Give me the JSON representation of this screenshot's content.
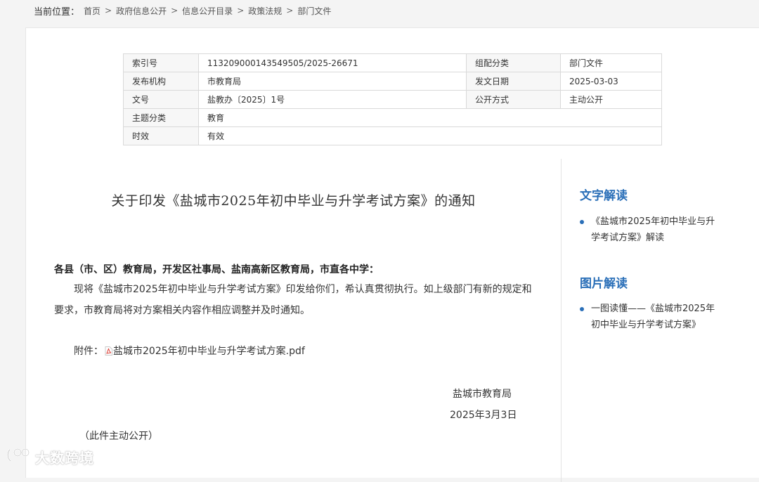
{
  "breadcrumb": {
    "label": "当前位置：",
    "items": [
      "首页",
      "政府信息公开",
      "信息公开目录",
      "政策法规",
      "部门文件"
    ],
    "separator": ">"
  },
  "meta_table": {
    "rows": [
      [
        "索引号",
        "113209000143549505/2025-26671",
        "组配分类",
        "部门文件"
      ],
      [
        "发布机构",
        "市教育局",
        "发文日期",
        "2025-03-03"
      ],
      [
        "文号",
        "盐教办〔2025〕1号",
        "公开方式",
        "主动公开"
      ],
      [
        "主题分类",
        "教育"
      ],
      [
        "时效",
        "有效"
      ]
    ]
  },
  "article": {
    "title": "关于印发《盐城市2025年初中毕业与升学考试方案》的通知",
    "addressee": "各县（市、区）教育局，开发区社事局、盐南高新区教育局，市直各中学：",
    "body": "现将《盐城市2025年初中毕业与升学考试方案》印发给你们，希认真贯彻执行。如上级部门有新的规定和要求，市教育局将对方案相关内容作相应调整并及时通知。",
    "attachment_label": "附件：",
    "attachment_name": "盐城市2025年初中毕业与升学考试方案.pdf",
    "signature_org": "盐城市教育局",
    "signature_date": "2025年3月3日",
    "public_note": "（此件主动公开）"
  },
  "sidebar": {
    "text_heading": "文字解读",
    "text_items": [
      "《盐城市2025年初中毕业与升学考试方案》解读"
    ],
    "image_heading": "图片解读",
    "image_items": [
      "一图读懂——《盐城市2025年初中毕业与升学考试方案》"
    ]
  },
  "watermark": {
    "text": "大数跨境"
  },
  "colors": {
    "accent": "#2a6fb8",
    "pdf_red": "#d9342b"
  }
}
